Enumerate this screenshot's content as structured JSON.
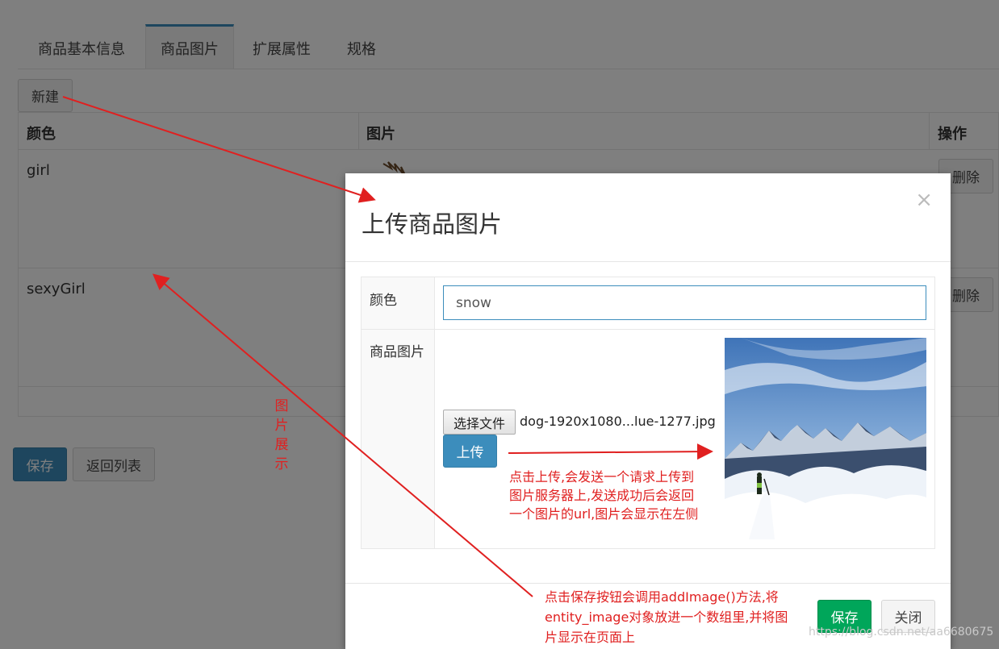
{
  "tabs": [
    "商品基本信息",
    "商品图片",
    "扩展属性",
    "规格"
  ],
  "toolbar": {
    "new_label": "新建"
  },
  "table": {
    "headers": {
      "color": "颜色",
      "image": "图片",
      "action": "操作"
    },
    "rows": [
      {
        "color": "girl",
        "delete_label": "删除"
      },
      {
        "color": "sexyGirl",
        "delete_label": "删除"
      }
    ]
  },
  "bottom_buttons": {
    "save_label": "保存",
    "back_label": "返回列表"
  },
  "modal": {
    "title": "上传商品图片",
    "close_symbol": "×",
    "color_label": "颜色",
    "color_value": "snow",
    "image_label": "商品图片",
    "choose_file_label": "选择文件",
    "file_name": "dog-1920x1080...lue-1277.jpg",
    "upload_label": "上传",
    "save_label": "保存",
    "close_label": "关闭"
  },
  "annotations": {
    "vertical_chars": [
      "图",
      "片",
      "展",
      "示"
    ],
    "upload_note_lines": [
      "点击上传,会发送一个请求上传到",
      "图片服务器上,发送成功后会返回",
      "一个图片的url,图片会显示在左侧"
    ],
    "save_note_lines": [
      "点击保存按钮会调用addImage()方法,将",
      "entity_image对象放进一个数组里,并将图",
      "片显示在页面上"
    ]
  },
  "watermark": "https://blog.csdn.net/aa6680675",
  "colors": {
    "primary": "#3c8dbc",
    "success": "#00a65a",
    "annotation": "#e02020"
  }
}
